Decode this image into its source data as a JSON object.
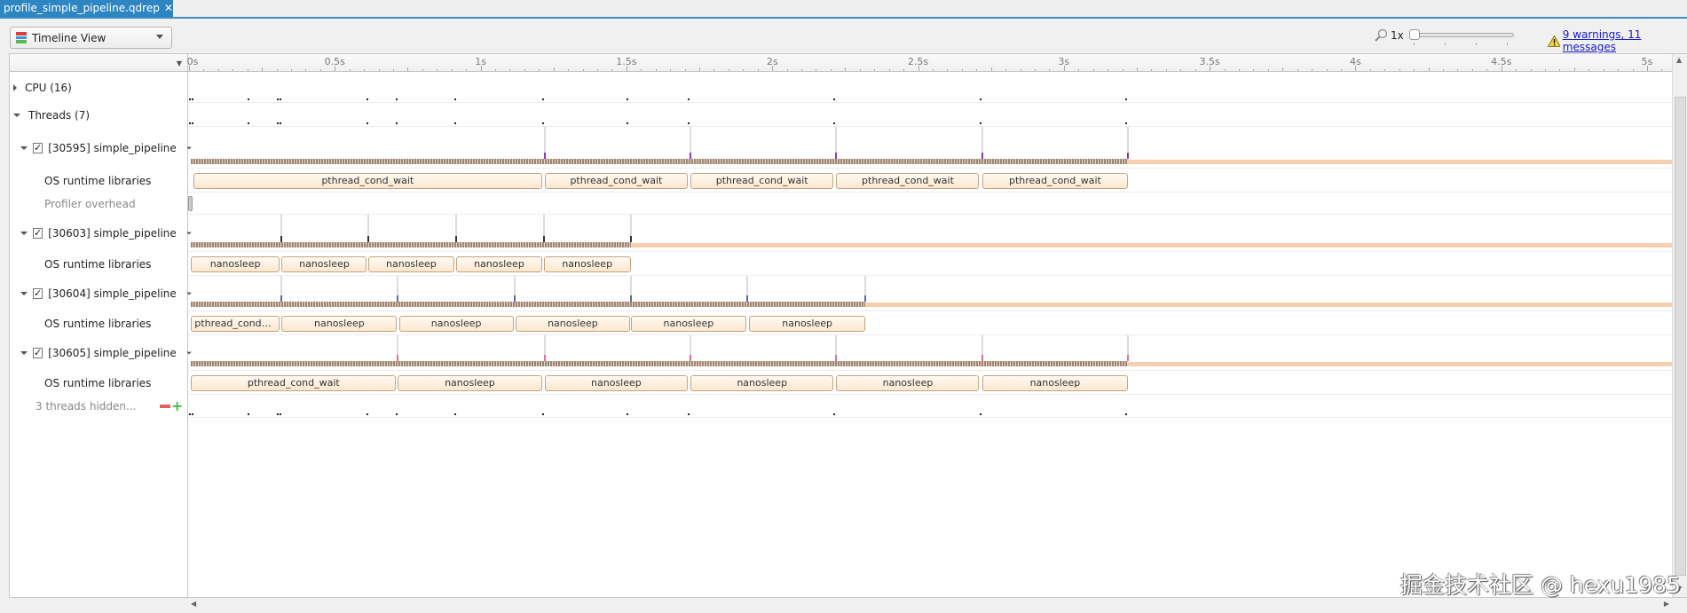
{
  "tab": {
    "title": "profile_simple_pipeline.qdrep",
    "close": "✕"
  },
  "toolbar": {
    "view_select": "Timeline View",
    "zoom_level": "1x",
    "warnings_link": "9 warnings, 11 messages"
  },
  "colors": {
    "accent": "#2d86c2",
    "event_border": "#c4a482",
    "event_fill": "#fde7cf",
    "hatch": "#a08674",
    "tail": "#f8cfae"
  },
  "ruler": {
    "labels": [
      {
        "t": 0,
        "text": "0s"
      },
      {
        "t": 0.5,
        "text": "0.5s"
      },
      {
        "t": 1,
        "text": "1s"
      },
      {
        "t": 1.5,
        "text": "1.5s"
      },
      {
        "t": 2,
        "text": "2s"
      },
      {
        "t": 2.5,
        "text": "2.5s"
      },
      {
        "t": 3,
        "text": "3s"
      },
      {
        "t": 3.5,
        "text": "3.5s"
      },
      {
        "t": 4,
        "text": "4s"
      },
      {
        "t": 4.5,
        "text": "4.5s"
      },
      {
        "t": 5,
        "text": "5s"
      }
    ],
    "max_seconds": 5.1
  },
  "rows": [
    {
      "kind": "group",
      "label": "CPU (16)",
      "expanded": false
    },
    {
      "kind": "group",
      "label": "Threads (7)",
      "expanded": true
    },
    {
      "kind": "thread",
      "label": "[30595] simple_pipeline",
      "checked": true,
      "active_end": 3.22,
      "marks": [
        1.22,
        1.72,
        2.22,
        2.72,
        3.22
      ],
      "mark_color": "#8a3ab8"
    },
    {
      "kind": "os",
      "label": "OS runtime libraries",
      "events": [
        {
          "name": "pthread_cond_wait",
          "start": 0.015,
          "end": 1.21
        },
        {
          "name": "pthread_cond_wait",
          "start": 1.22,
          "end": 1.71
        },
        {
          "name": "pthread_cond_wait",
          "start": 1.72,
          "end": 2.21
        },
        {
          "name": "pthread_cond_wait",
          "start": 2.22,
          "end": 2.71
        },
        {
          "name": "pthread_cond_wait",
          "start": 2.72,
          "end": 3.22
        }
      ]
    },
    {
      "kind": "overhead",
      "label": "Profiler overhead"
    },
    {
      "kind": "thread",
      "label": "[30603] simple_pipeline",
      "checked": true,
      "active_end": 1.515,
      "marks": [
        0.315,
        0.614,
        0.917,
        1.216,
        1.515
      ],
      "mark_color": "#333"
    },
    {
      "kind": "os",
      "label": "OS runtime libraries",
      "events": [
        {
          "name": "nanosleep",
          "start": 0.007,
          "end": 0.31
        },
        {
          "name": "nanosleep",
          "start": 0.318,
          "end": 0.61
        },
        {
          "name": "nanosleep",
          "start": 0.614,
          "end": 0.91
        },
        {
          "name": "nanosleep",
          "start": 0.917,
          "end": 1.21
        },
        {
          "name": "nanosleep",
          "start": 1.216,
          "end": 1.515
        }
      ]
    },
    {
      "kind": "thread",
      "label": "[30604] simple_pipeline",
      "checked": true,
      "active_end": 2.32,
      "marks": [
        0.315,
        0.716,
        1.116,
        1.514,
        1.915,
        2.32
      ],
      "mark_color": "#5a6aa0"
    },
    {
      "kind": "os",
      "label": "OS runtime libraries",
      "events": [
        {
          "name": "pthread_cond_…",
          "start": 0.007,
          "end": 0.31
        },
        {
          "name": "nanosleep",
          "start": 0.318,
          "end": 0.713
        },
        {
          "name": "nanosleep",
          "start": 0.72,
          "end": 1.113
        },
        {
          "name": "nanosleep",
          "start": 1.12,
          "end": 1.512
        },
        {
          "name": "nanosleep",
          "start": 1.516,
          "end": 1.91
        },
        {
          "name": "nanosleep",
          "start": 1.92,
          "end": 2.32
        }
      ]
    },
    {
      "kind": "thread",
      "label": "[30605] simple_pipeline",
      "checked": true,
      "active_end": 3.22,
      "marks": [
        0.716,
        1.22,
        1.72,
        2.22,
        2.72,
        3.22
      ],
      "mark_color": "#e07090"
    },
    {
      "kind": "os",
      "label": "OS runtime libraries",
      "events": [
        {
          "name": "pthread_cond_wait",
          "start": 0.007,
          "end": 0.71
        },
        {
          "name": "nanosleep",
          "start": 0.716,
          "end": 1.21
        },
        {
          "name": "nanosleep",
          "start": 1.22,
          "end": 1.71
        },
        {
          "name": "nanosleep",
          "start": 1.72,
          "end": 2.21
        },
        {
          "name": "nanosleep",
          "start": 2.22,
          "end": 2.71
        },
        {
          "name": "nanosleep",
          "start": 2.72,
          "end": 3.22
        }
      ]
    },
    {
      "kind": "hidden",
      "label": "3 threads hidden..."
    }
  ],
  "watermark": "掘金技术社区 @ hexu1985"
}
